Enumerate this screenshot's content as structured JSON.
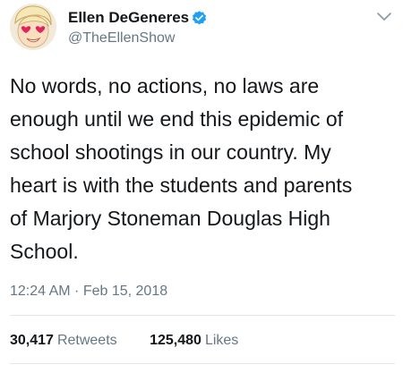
{
  "author": {
    "display_name": "Ellen DeGeneres",
    "handle": "@TheEllenShow",
    "verified_icon": "verified-badge-icon",
    "avatar_icon": "heart-eyes-emoji-avatar"
  },
  "tweet": {
    "lines": [
      "No words, no actions, no laws are",
      "enough until we end this epidemic of",
      "school shootings in our country. My",
      "heart is with the students and parents",
      "of Marjory Stoneman Douglas High",
      "School."
    ],
    "timestamp": "12:24 AM · Feb 15, 2018"
  },
  "stats": {
    "retweets_count": "30,417",
    "retweets_label": "Retweets",
    "likes_count": "125,480",
    "likes_label": "Likes"
  },
  "colors": {
    "text": "#14171a",
    "secondary": "#657786",
    "verified": "#1da1f2",
    "divider": "#e1e8ed"
  },
  "icons": {
    "menu": "chevron-down-icon"
  }
}
